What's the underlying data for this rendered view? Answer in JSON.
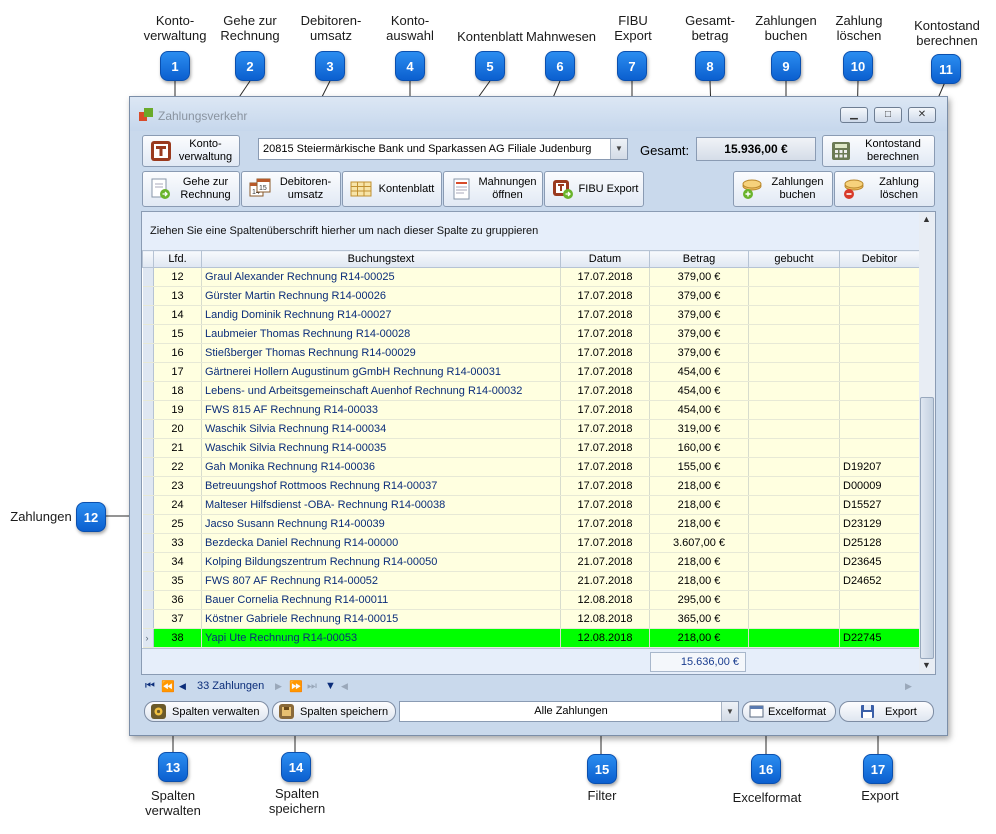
{
  "window": {
    "title": "Zahlungsverkehr"
  },
  "callouts": [
    {
      "num": "1",
      "label": "Konto-\nverwaltung"
    },
    {
      "num": "2",
      "label": "Gehe zur\nRechnung"
    },
    {
      "num": "3",
      "label": "Debitoren-\numsatz"
    },
    {
      "num": "4",
      "label": "Konto-\nauswahl"
    },
    {
      "num": "5",
      "label": "Kontenblatt"
    },
    {
      "num": "6",
      "label": "Mahnwesen"
    },
    {
      "num": "7",
      "label": "FIBU\nExport"
    },
    {
      "num": "8",
      "label": "Gesamt-\nbetrag"
    },
    {
      "num": "9",
      "label": "Zahlungen\nbuchen"
    },
    {
      "num": "10",
      "label": "Zahlung\nlöschen"
    },
    {
      "num": "11",
      "label": "Kontostand\nberechnen"
    },
    {
      "num": "12",
      "label": "Zahlungen"
    },
    {
      "num": "13",
      "label": "Spalten\nverwalten"
    },
    {
      "num": "14",
      "label": "Spalten\nspeichern"
    },
    {
      "num": "15",
      "label": "Filter"
    },
    {
      "num": "16",
      "label": "Excelformat"
    },
    {
      "num": "17",
      "label": "Export"
    }
  ],
  "toolbar": {
    "kontoverwaltung": "Konto-\nverwaltung",
    "konto_selected": "20815 Steiermärkische Bank und Sparkassen AG Filiale Judenburg",
    "gesamt_label": "Gesamt:",
    "gesamt_value": "15.936,00 €",
    "kontostand": "Kontostand\nberechnen",
    "gehe_zur_rechnung": "Gehe zur\nRechnung",
    "debitorenumsatz": "Debitoren-\numsatz",
    "kontenblatt": "Kontenblatt",
    "mahnungen": "Mahnungen\nöffnen",
    "fibu_export": "FIBU Export",
    "zahlungen_buchen": "Zahlungen\nbuchen",
    "zahlung_loeschen": "Zahlung\nlöschen"
  },
  "grid": {
    "group_hint": "Ziehen Sie eine Spaltenüberschrift hierher um nach dieser Spalte zu gruppieren",
    "columns": [
      "Lfd.",
      "Buchungstext",
      "Datum",
      "Betrag",
      "gebucht",
      "Debitor"
    ],
    "rows": [
      {
        "lfd": "12",
        "text": "Graul Alexander Rechnung R14-00025",
        "datum": "17.07.2018",
        "betrag": "379,00 €",
        "gebucht": "",
        "debitor": ""
      },
      {
        "lfd": "13",
        "text": "Gürster Martin Rechnung R14-00026",
        "datum": "17.07.2018",
        "betrag": "379,00 €",
        "gebucht": "",
        "debitor": ""
      },
      {
        "lfd": "14",
        "text": "Landig Dominik Rechnung R14-00027",
        "datum": "17.07.2018",
        "betrag": "379,00 €",
        "gebucht": "",
        "debitor": ""
      },
      {
        "lfd": "15",
        "text": "Laubmeier Thomas Rechnung R14-00028",
        "datum": "17.07.2018",
        "betrag": "379,00 €",
        "gebucht": "",
        "debitor": ""
      },
      {
        "lfd": "16",
        "text": "Stießberger Thomas Rechnung R14-00029",
        "datum": "17.07.2018",
        "betrag": "379,00 €",
        "gebucht": "",
        "debitor": ""
      },
      {
        "lfd": "17",
        "text": "Gärtnerei Hollern Augustinum gGmbH Rechnung R14-00031",
        "datum": "17.07.2018",
        "betrag": "454,00 €",
        "gebucht": "",
        "debitor": ""
      },
      {
        "lfd": "18",
        "text": "Lebens- und Arbeitsgemeinschaft Auenhof Rechnung R14-00032",
        "datum": "17.07.2018",
        "betrag": "454,00 €",
        "gebucht": "",
        "debitor": ""
      },
      {
        "lfd": "19",
        "text": "FWS 815 AF Rechnung R14-00033",
        "datum": "17.07.2018",
        "betrag": "454,00 €",
        "gebucht": "",
        "debitor": ""
      },
      {
        "lfd": "20",
        "text": "Waschik Silvia Rechnung R14-00034",
        "datum": "17.07.2018",
        "betrag": "319,00 €",
        "gebucht": "",
        "debitor": ""
      },
      {
        "lfd": "21",
        "text": "Waschik Silvia Rechnung R14-00035",
        "datum": "17.07.2018",
        "betrag": "160,00 €",
        "gebucht": "",
        "debitor": ""
      },
      {
        "lfd": "22",
        "text": "Gah Monika Rechnung R14-00036",
        "datum": "17.07.2018",
        "betrag": "155,00 €",
        "gebucht": "",
        "debitor": "D19207"
      },
      {
        "lfd": "23",
        "text": "Betreuungshof Rottmoos Rechnung R14-00037",
        "datum": "17.07.2018",
        "betrag": "218,00 €",
        "gebucht": "",
        "debitor": "D00009"
      },
      {
        "lfd": "24",
        "text": "Malteser Hilfsdienst -OBA- Rechnung R14-00038",
        "datum": "17.07.2018",
        "betrag": "218,00 €",
        "gebucht": "",
        "debitor": "D15527"
      },
      {
        "lfd": "25",
        "text": "Jacso Susann Rechnung R14-00039",
        "datum": "17.07.2018",
        "betrag": "218,00 €",
        "gebucht": "",
        "debitor": "D23129"
      },
      {
        "lfd": "33",
        "text": "Bezdecka Daniel Rechnung R14-00000",
        "datum": "17.07.2018",
        "betrag": "3.607,00 €",
        "gebucht": "",
        "debitor": "D25128"
      },
      {
        "lfd": "34",
        "text": "Kolping Bildungszentrum Rechnung R14-00050",
        "datum": "21.07.2018",
        "betrag": "218,00 €",
        "gebucht": "",
        "debitor": "D23645"
      },
      {
        "lfd": "35",
        "text": "FWS 807 AF Rechnung R14-00052",
        "datum": "21.07.2018",
        "betrag": "218,00 €",
        "gebucht": "",
        "debitor": "D24652"
      },
      {
        "lfd": "36",
        "text": "Bauer Cornelia Rechnung R14-00011",
        "datum": "12.08.2018",
        "betrag": "295,00 €",
        "gebucht": "",
        "debitor": ""
      },
      {
        "lfd": "37",
        "text": "Köstner Gabriele Rechnung R14-00015",
        "datum": "12.08.2018",
        "betrag": "365,00 €",
        "gebucht": "",
        "debitor": ""
      },
      {
        "lfd": "38",
        "text": "Yapi Ute Rechnung R14-00053",
        "datum": "12.08.2018",
        "betrag": "218,00 €",
        "gebucht": "",
        "debitor": "D22745",
        "selected": true
      }
    ],
    "sum_betrag": "15.636,00 €",
    "selected_row_color": "#00ff00",
    "row_color": "#ffffe0"
  },
  "navigator": {
    "record_count": "33 Zahlungen"
  },
  "bottom": {
    "spalten_verwalten": "Spalten verwalten",
    "spalten_speichern": "Spalten speichern",
    "filter_value": "Alle Zahlungen",
    "excelformat": "Excelformat",
    "export": "Export"
  },
  "colors": {
    "badge": "#1a74e0",
    "window_bg": "#c9d9ec"
  }
}
